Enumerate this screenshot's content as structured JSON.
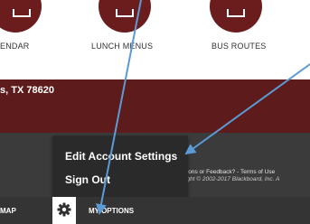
{
  "quick_links": [
    {
      "label": "ENDAR",
      "icon": "calendar-icon"
    },
    {
      "label": "LUNCH MENUS",
      "icon": "lunch-icon"
    },
    {
      "label": "BUS ROUTES",
      "icon": "bus-icon"
    }
  ],
  "address": {
    "text": "s, TX 78620"
  },
  "footer": {
    "line1": "tions or Feedback? - Terms of Use",
    "line2": "ight © 2002-2017 Blackboard, Inc. A"
  },
  "dropdown": {
    "items": [
      {
        "label": "Edit Account Settings"
      },
      {
        "label": "Sign Out"
      }
    ]
  },
  "bottom_bar": {
    "map_label": "MAP",
    "options_icon": "gear-icon",
    "options_label": "MY OPTIONS"
  },
  "annotation": {
    "arrow_color": "#5b9bd5"
  },
  "colors": {
    "maroon": "#5e1b1b",
    "dark_gray": "#3b3b3b",
    "dropdown_bg": "#2a2a2a"
  }
}
